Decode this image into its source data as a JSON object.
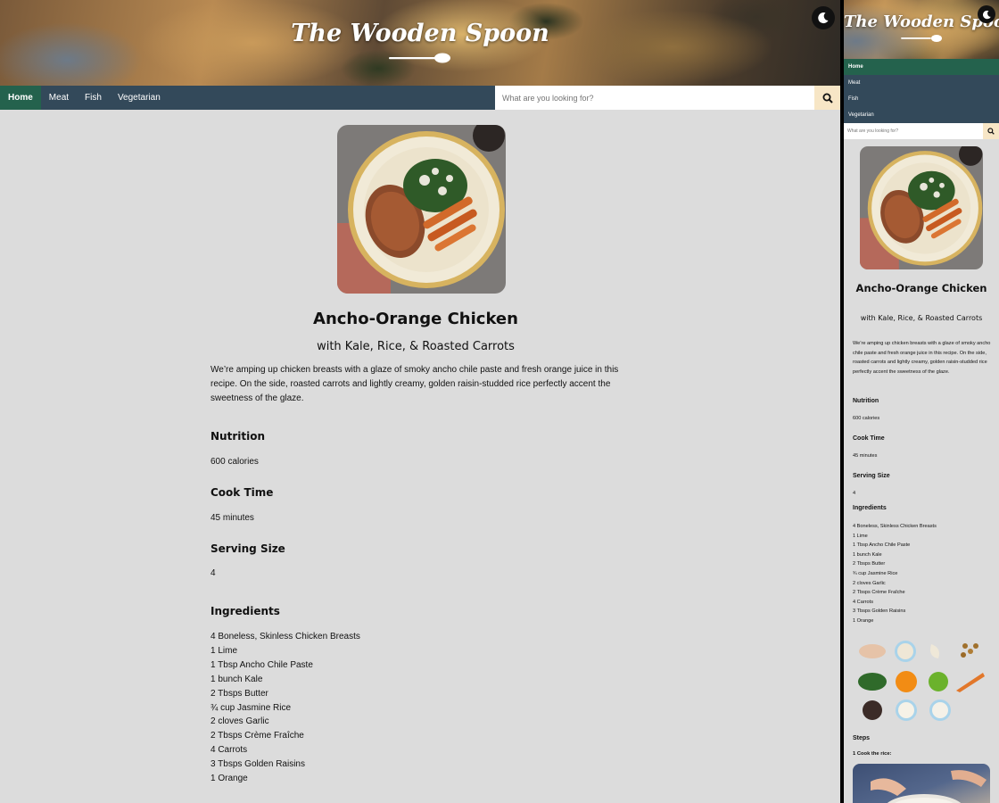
{
  "brand": {
    "name": "The Wooden Spoon"
  },
  "nav": {
    "items": [
      {
        "label": "Home",
        "active": true
      },
      {
        "label": "Meat",
        "active": false
      },
      {
        "label": "Fish",
        "active": false
      },
      {
        "label": "Vegetarian",
        "active": false
      }
    ]
  },
  "search": {
    "placeholder": "What are you looking for?",
    "value": ""
  },
  "icons": {
    "theme_toggle": "moon-icon",
    "search": "search-icon",
    "logo": "spoon-icon"
  },
  "recipe": {
    "title": "Ancho-Orange Chicken",
    "subtitle": "with Kale, Rice, & Roasted Carrots",
    "description": "We’re amping up chicken breasts with a glaze of smoky ancho chile paste and fresh orange juice in this recipe. On the side, roasted carrots and lightly creamy, golden raisin-studded rice perfectly accent the sweetness of the glaze.",
    "nutrition_label": "Nutrition",
    "nutrition_value": "600 calories",
    "cook_time_label": "Cook Time",
    "cook_time_value": "45 minutes",
    "serving_label": "Serving Size",
    "serving_value": "4",
    "ingredients_label": "Ingredients",
    "ingredients": [
      "4 Boneless, Skinless Chicken Breasts",
      "1 Lime",
      "1 Tbsp Ancho Chile Paste",
      "1 bunch Kale",
      "2 Tbsps Butter",
      "¾ cup Jasmine Rice",
      "2 cloves Garlic",
      "2 Tbsps Crème Fraîche",
      "4 Carrots",
      "3 Tbsps Golden Raisins",
      "1 Orange"
    ],
    "steps_label": "Steps",
    "steps": [
      {
        "title": "1 Cook the rice:"
      }
    ]
  },
  "colors": {
    "nav": "#33495a",
    "nav_active": "#24624d",
    "search_button": "#f7e6c6",
    "page_bg": "#dcdcdc"
  }
}
